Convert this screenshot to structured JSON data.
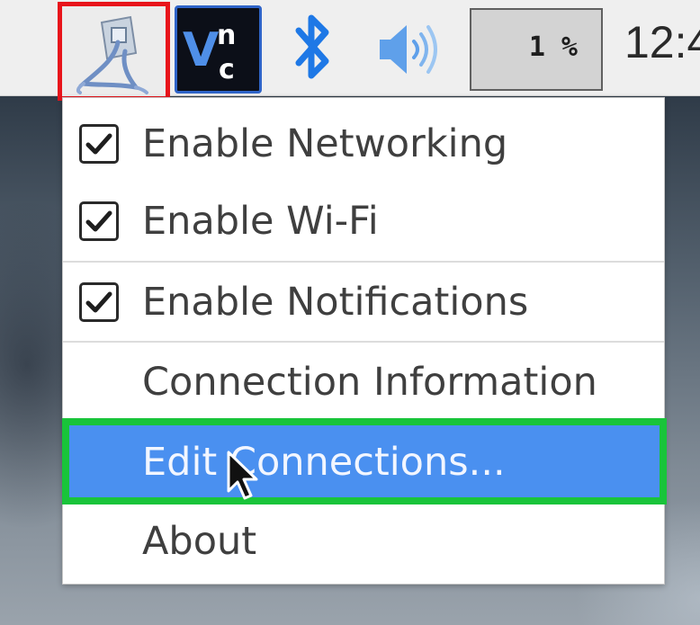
{
  "taskbar": {
    "network_icon": "network-wired-icon",
    "vnc_icon": "vnc-icon",
    "vnc_label": "Vnc",
    "bluetooth_icon": "bluetooth-icon",
    "volume_icon": "volume-icon",
    "cpu_usage": "1 %",
    "clock": "12:4"
  },
  "menu": {
    "items": [
      {
        "label": "Enable Networking",
        "checked": true
      },
      {
        "label": "Enable Wi-Fi",
        "checked": true
      },
      {
        "label": "Enable Notifications",
        "checked": true
      },
      {
        "label": "Connection Information"
      },
      {
        "label": "Edit Connections...",
        "highlighted": true
      },
      {
        "label": "About"
      }
    ]
  },
  "colors": {
    "highlight": "#4a90f0",
    "annotation_red": "#e8141b",
    "annotation_green": "#19c43a",
    "bluetooth": "#1e78e6"
  }
}
